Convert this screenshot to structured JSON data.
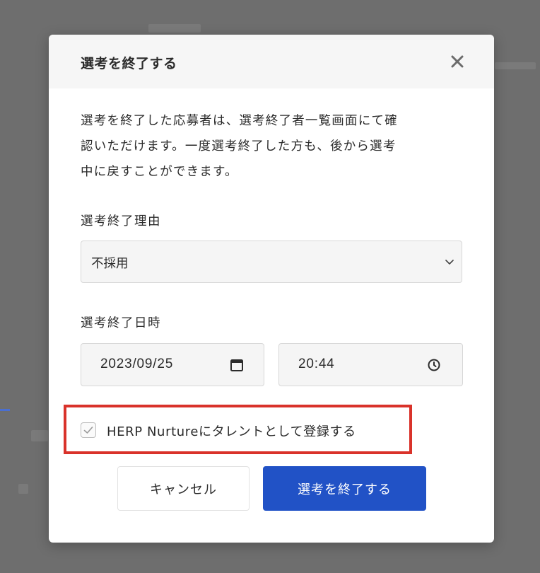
{
  "dialog": {
    "title": "選考を終了する",
    "close_icon": "close-icon",
    "description_lines": [
      "選考を終了した応募者は、選考終了者一覧画面にて確",
      "認いただけます。一度選考終了した方も、後から選考",
      "中に戻すことができます。"
    ],
    "reason": {
      "label": "選考終了理由",
      "selected": "不採用",
      "icon": "chevron-down-icon"
    },
    "datetime": {
      "label": "選考終了日時",
      "date": "2023/09/25",
      "date_icon": "calendar-icon",
      "time": "20:44",
      "time_icon": "clock-icon"
    },
    "nurture": {
      "label": "HERP Nurtureにタレントとして登録する",
      "checked": true,
      "highlight_color": "#d9322a"
    },
    "buttons": {
      "cancel": "キャンセル",
      "confirm": "選考を終了する"
    }
  },
  "colors": {
    "overlay": "#6e6e6e",
    "primary": "#2152c6",
    "input_bg": "#f5f5f5"
  }
}
